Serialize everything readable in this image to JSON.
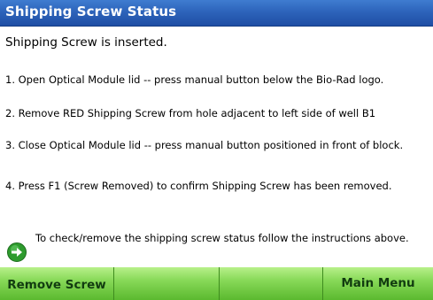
{
  "window": {
    "title": "Shipping Screw Status"
  },
  "status": {
    "message": "Shipping Screw is inserted."
  },
  "steps": [
    {
      "text": "1. Open Optical Module lid -- press manual button below the Bio-Rad logo."
    },
    {
      "text": "2. Remove RED Shipping Screw from hole adjacent to left side of well B1"
    },
    {
      "text": "3. Close Optical Module lid -- press manual button positioned in front of block."
    },
    {
      "text": "4. Press F1 (Screw Removed) to confirm Shipping Screw has been removed."
    }
  ],
  "hint": {
    "icon": "green-arrow-icon",
    "text": "To check/remove the shipping screw status follow the instructions above."
  },
  "softkeys": [
    {
      "label": "Remove Screw"
    },
    {
      "label": ""
    },
    {
      "label": ""
    },
    {
      "label": "Main Menu"
    }
  ],
  "colors": {
    "title_bar": "#2d64bb",
    "softkey_green": "#87d958",
    "icon_green": "#2e9b2e"
  }
}
